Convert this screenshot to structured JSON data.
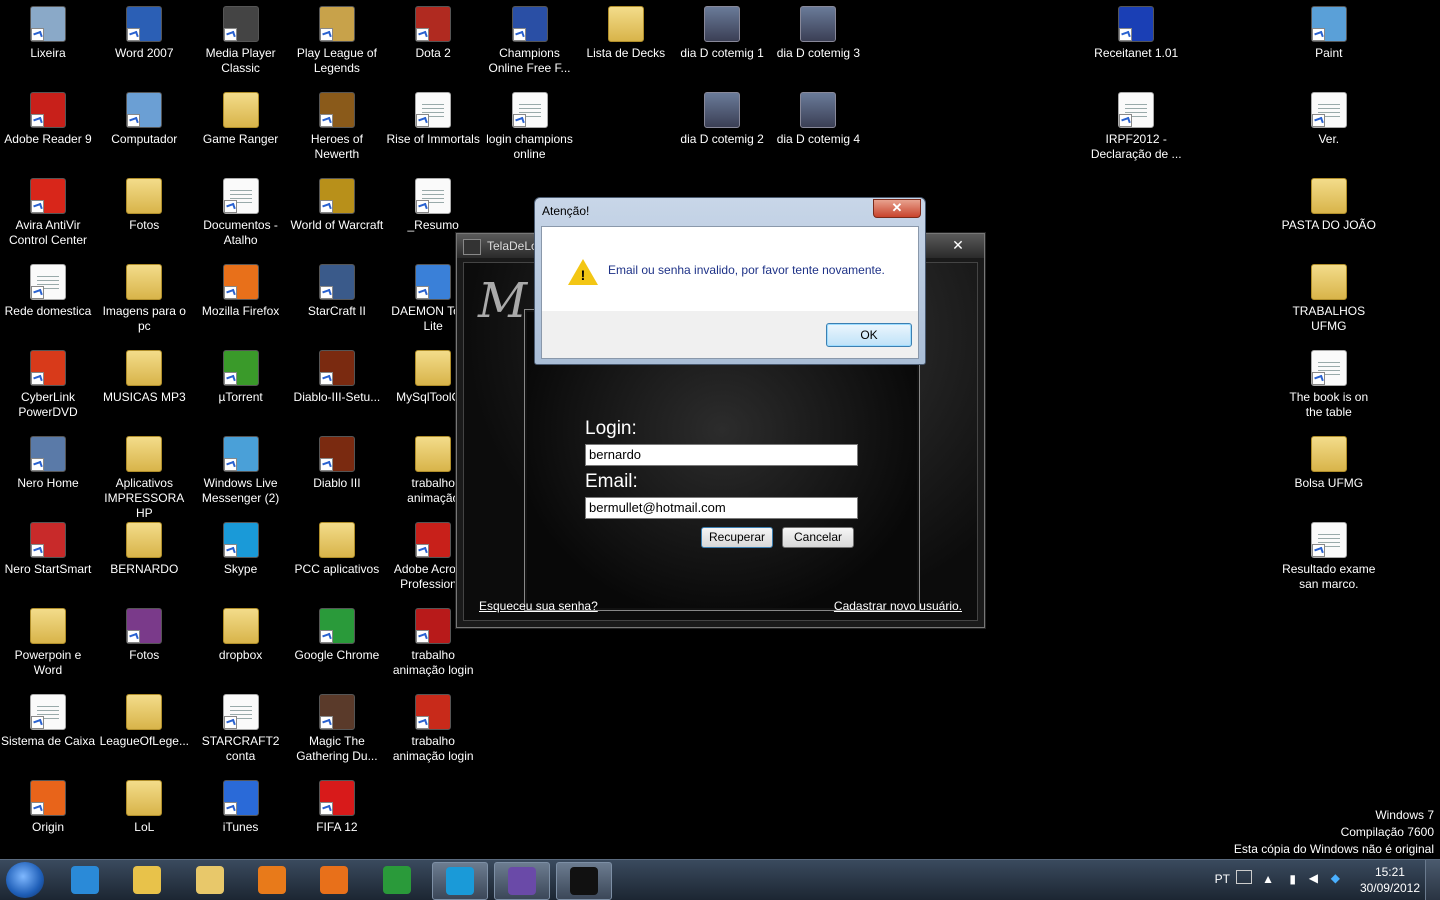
{
  "desktop_icons": [
    {
      "label": "Lixeira",
      "col": 0,
      "row": 0,
      "kind": "app",
      "color": "#8aa9c8",
      "icon": "recycle-bin-icon"
    },
    {
      "label": "Word 2007",
      "col": 1,
      "row": 0,
      "kind": "app",
      "color": "#2b5fb5",
      "icon": "word-icon"
    },
    {
      "label": "Media Player Classic",
      "col": 2,
      "row": 0,
      "kind": "app",
      "color": "#444",
      "icon": "media-player-icon"
    },
    {
      "label": "Play League of Legends",
      "col": 3,
      "row": 0,
      "kind": "app",
      "color": "#c8a24a",
      "icon": "league-icon"
    },
    {
      "label": "Dota 2",
      "col": 4,
      "row": 0,
      "kind": "app",
      "color": "#b02a20",
      "icon": "dota-icon"
    },
    {
      "label": "Champions Online Free F...",
      "col": 5,
      "row": 0,
      "kind": "app",
      "color": "#2a4fa5",
      "icon": "champions-online-icon"
    },
    {
      "label": "Lista de Decks",
      "col": 6,
      "row": 0,
      "kind": "folder",
      "icon": "folder-icon"
    },
    {
      "label": "dia D cotemig 1",
      "col": 7,
      "row": 0,
      "kind": "photo",
      "icon": "photo-icon"
    },
    {
      "label": "dia D cotemig 3",
      "col": 8,
      "row": 0,
      "kind": "photo",
      "icon": "photo-icon"
    },
    {
      "label": "Receitanet 1.01",
      "col": 11.3,
      "row": 0,
      "kind": "app",
      "color": "#1a3fb5",
      "icon": "receitanet-icon"
    },
    {
      "label": "Paint",
      "col": 13.3,
      "row": 0,
      "kind": "app",
      "color": "#5aa0d8",
      "icon": "paint-icon"
    },
    {
      "label": "Adobe Reader 9",
      "col": 0,
      "row": 1,
      "kind": "app",
      "color": "#c8201a",
      "icon": "adobe-reader-icon"
    },
    {
      "label": "Computador",
      "col": 1,
      "row": 1,
      "kind": "app",
      "color": "#6b9fd4",
      "icon": "computer-icon"
    },
    {
      "label": "Game Ranger",
      "col": 2,
      "row": 1,
      "kind": "folder",
      "icon": "folder-icon"
    },
    {
      "label": "Heroes of Newerth",
      "col": 3,
      "row": 1,
      "kind": "app",
      "color": "#8a5a1a",
      "icon": "hon-icon"
    },
    {
      "label": "Rise of Immortals",
      "col": 4,
      "row": 1,
      "kind": "doc",
      "icon": "document-icon"
    },
    {
      "label": "login champions online",
      "col": 5,
      "row": 1,
      "kind": "doc",
      "icon": "document-icon"
    },
    {
      "label": "dia D cotemig 2",
      "col": 7,
      "row": 1,
      "kind": "photo",
      "icon": "photo-icon"
    },
    {
      "label": "dia D cotemig 4",
      "col": 8,
      "row": 1,
      "kind": "photo",
      "icon": "photo-icon"
    },
    {
      "label": "IRPF2012 - Declaração de ...",
      "col": 11.3,
      "row": 1,
      "kind": "doc",
      "icon": "document-icon"
    },
    {
      "label": "Ver.",
      "col": 13.3,
      "row": 1,
      "kind": "doc",
      "icon": "document-icon"
    },
    {
      "label": "Avira AntiVir Control Center",
      "col": 0,
      "row": 2,
      "kind": "app",
      "color": "#d8261a",
      "icon": "avira-icon"
    },
    {
      "label": "Fotos",
      "col": 1,
      "row": 2,
      "kind": "folder",
      "icon": "folder-icon"
    },
    {
      "label": "Documentos - Atalho",
      "col": 2,
      "row": 2,
      "kind": "doc",
      "icon": "document-icon"
    },
    {
      "label": "World of Warcraft",
      "col": 3,
      "row": 2,
      "kind": "app",
      "color": "#b8901a",
      "icon": "wow-icon"
    },
    {
      "label": "_Resumo",
      "col": 4,
      "row": 2,
      "kind": "doc",
      "icon": "word-doc-icon"
    },
    {
      "label": "PASTA DO JOÃO",
      "col": 13.3,
      "row": 2,
      "kind": "folder",
      "icon": "folder-icon"
    },
    {
      "label": "Rede domestica",
      "col": 0,
      "row": 3,
      "kind": "doc",
      "icon": "document-icon"
    },
    {
      "label": "Imagens para o pc",
      "col": 1,
      "row": 3,
      "kind": "folder",
      "icon": "folder-icon"
    },
    {
      "label": "Mozilla Firefox",
      "col": 2,
      "row": 3,
      "kind": "app",
      "color": "#e8701a",
      "icon": "firefox-icon"
    },
    {
      "label": "StarCraft II",
      "col": 3,
      "row": 3,
      "kind": "app",
      "color": "#3a5a8a",
      "icon": "starcraft-icon"
    },
    {
      "label": "DAEMON Tools Lite",
      "col": 4,
      "row": 3,
      "kind": "app",
      "color": "#3a80d8",
      "icon": "daemon-tools-icon"
    },
    {
      "label": "TRABALHOS UFMG",
      "col": 13.3,
      "row": 3,
      "kind": "folder",
      "icon": "folder-icon"
    },
    {
      "label": "CyberLink PowerDVD",
      "col": 0,
      "row": 4,
      "kind": "app",
      "color": "#d83a1a",
      "icon": "powerdvd-icon"
    },
    {
      "label": "MUSICAS MP3",
      "col": 1,
      "row": 4,
      "kind": "folder",
      "icon": "folder-icon"
    },
    {
      "label": "µTorrent",
      "col": 2,
      "row": 4,
      "kind": "app",
      "color": "#3a9a2a",
      "icon": "utorrent-icon"
    },
    {
      "label": "Diablo-III-Setu...",
      "col": 3,
      "row": 4,
      "kind": "app",
      "color": "#7a2a10",
      "icon": "diablo-icon"
    },
    {
      "label": "MySqlToolC...",
      "col": 4,
      "row": 4,
      "kind": "folder",
      "icon": "folder-icon"
    },
    {
      "label": "The book is on the table",
      "col": 13.3,
      "row": 4,
      "kind": "doc",
      "icon": "word-doc-icon"
    },
    {
      "label": "Nero Home",
      "col": 0,
      "row": 5,
      "kind": "app",
      "color": "#5a7aa8",
      "icon": "nero-icon"
    },
    {
      "label": "Aplicativos IMPRESSORA HP",
      "col": 1,
      "row": 5,
      "kind": "folder",
      "icon": "folder-icon"
    },
    {
      "label": "Windows Live Messenger (2)",
      "col": 2,
      "row": 5,
      "kind": "app",
      "color": "#4aa0d8",
      "icon": "messenger-icon"
    },
    {
      "label": "Diablo III",
      "col": 3,
      "row": 5,
      "kind": "app",
      "color": "#7a2a10",
      "icon": "diablo-icon"
    },
    {
      "label": "trabalho animação",
      "col": 4,
      "row": 5,
      "kind": "folder",
      "icon": "folder-icon"
    },
    {
      "label": "Bolsa UFMG",
      "col": 13.3,
      "row": 5,
      "kind": "folder",
      "icon": "folder-icon"
    },
    {
      "label": "Nero StartSmart",
      "col": 0,
      "row": 6,
      "kind": "app",
      "color": "#c82a2a",
      "icon": "nero-startsmart-icon"
    },
    {
      "label": "BERNARDO",
      "col": 1,
      "row": 6,
      "kind": "folder",
      "icon": "folder-icon"
    },
    {
      "label": "Skype",
      "col": 2,
      "row": 6,
      "kind": "app",
      "color": "#1a9ad8",
      "icon": "skype-icon"
    },
    {
      "label": "PCC aplicativos",
      "col": 3,
      "row": 6,
      "kind": "folder",
      "icon": "folder-icon"
    },
    {
      "label": "Adobe Acrobat Professional",
      "col": 4,
      "row": 6,
      "kind": "app",
      "color": "#c8201a",
      "icon": "acrobat-icon"
    },
    {
      "label": "Resultado exame san marco.",
      "col": 13.3,
      "row": 6,
      "kind": "doc",
      "icon": "document-icon"
    },
    {
      "label": "Powerpoin e Word",
      "col": 0,
      "row": 7,
      "kind": "folder",
      "icon": "folder-icon"
    },
    {
      "label": "Fotos",
      "col": 1,
      "row": 7,
      "kind": "app",
      "color": "#7a3a8a",
      "icon": "winrar-icon"
    },
    {
      "label": "dropbox",
      "col": 2,
      "row": 7,
      "kind": "folder",
      "icon": "folder-icon"
    },
    {
      "label": "Google Chrome",
      "col": 3,
      "row": 7,
      "kind": "app",
      "color": "#2a9a3a",
      "icon": "chrome-icon"
    },
    {
      "label": "trabalho animação login",
      "col": 4,
      "row": 7,
      "kind": "app",
      "color": "#b81a1a",
      "icon": "flash-fla-icon"
    },
    {
      "label": "Sistema de Caixa",
      "col": 0,
      "row": 8,
      "kind": "doc",
      "icon": "document-icon"
    },
    {
      "label": "LeagueOfLege...",
      "col": 1,
      "row": 8,
      "kind": "folder",
      "icon": "folder-icon"
    },
    {
      "label": "STARCRAFT2 conta",
      "col": 2,
      "row": 8,
      "kind": "doc",
      "icon": "document-icon"
    },
    {
      "label": "Magic The Gathering Du...",
      "col": 3,
      "row": 8,
      "kind": "app",
      "color": "#5a3a2a",
      "icon": "magic-icon"
    },
    {
      "label": "trabalho animação login",
      "col": 4,
      "row": 8,
      "kind": "app",
      "color": "#c82a1a",
      "icon": "flash-swf-icon"
    },
    {
      "label": "Origin",
      "col": 0,
      "row": 9,
      "kind": "app",
      "color": "#e8641a",
      "icon": "origin-icon"
    },
    {
      "label": "LoL",
      "col": 1,
      "row": 9,
      "kind": "folder",
      "icon": "folder-icon"
    },
    {
      "label": "iTunes",
      "col": 2,
      "row": 9,
      "kind": "app",
      "color": "#2a6ad8",
      "icon": "itunes-icon"
    },
    {
      "label": "FIFA 12",
      "col": 3,
      "row": 9,
      "kind": "app",
      "color": "#d81a1a",
      "icon": "fifa-icon"
    }
  ],
  "login_window": {
    "title": "TelaDeLo",
    "close": "✕",
    "logo_letter": "M",
    "login_label": "Login:",
    "login_value": "bernardo",
    "email_label": "Email:",
    "email_value": "bermullet@hotmail.com",
    "recover_button": "Recuperar",
    "cancel_button": "Cancelar",
    "forgot_link": "Esqueceu sua senha?",
    "register_link": "Cadastrar novo usuário."
  },
  "alert": {
    "title": "Atenção!",
    "close": "✕",
    "message": "Email ou senha invalido, por favor tente novamente.",
    "ok_button": "OK"
  },
  "watermark": {
    "line1": "Windows 7",
    "line2": "Compilação 7600",
    "line3": "Esta cópia do Windows não é original"
  },
  "taskbar": {
    "pinned": [
      {
        "name": "internet-explorer-icon",
        "color": "#2a8ad8",
        "active": false
      },
      {
        "name": "outlook-icon",
        "color": "#e8c24a",
        "active": false
      },
      {
        "name": "explorer-folder-icon",
        "color": "#e8c86a",
        "active": false
      },
      {
        "name": "media-player-taskbar-icon",
        "color": "#e87a1a",
        "active": false
      },
      {
        "name": "firefox-taskbar-icon",
        "color": "#e8701a",
        "active": false
      },
      {
        "name": "chrome-taskbar-icon",
        "color": "#2a9a3a",
        "active": false
      },
      {
        "name": "skype-taskbar-icon",
        "color": "#1a9ad8",
        "active": true
      },
      {
        "name": "visual-studio-icon",
        "color": "#6a4aa8",
        "active": true
      },
      {
        "name": "mysql-toolc-icon",
        "color": "#111",
        "active": true
      }
    ],
    "language": "PT",
    "time": "15:21",
    "date": "30/09/2012"
  }
}
